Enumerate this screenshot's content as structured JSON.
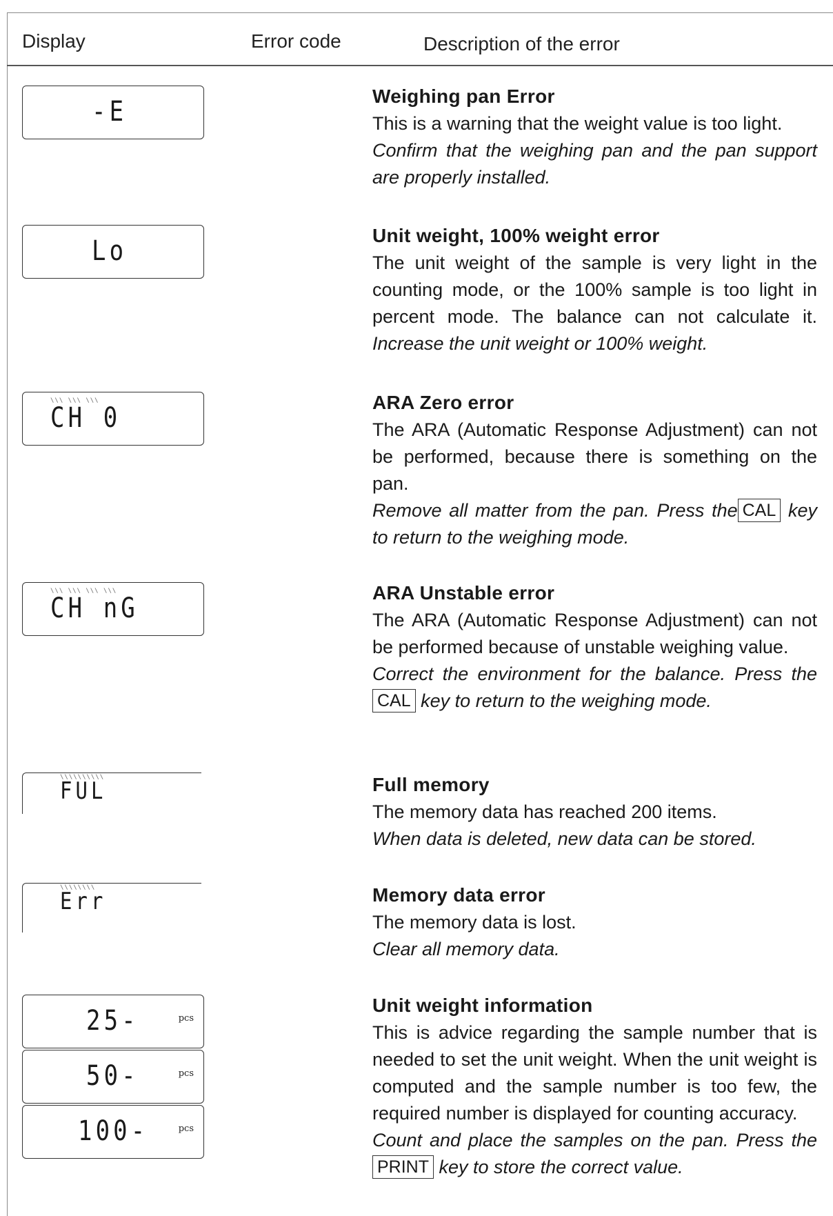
{
  "header": {
    "display": "Display",
    "error_code": "Error code",
    "description": "Description of the error"
  },
  "entries": [
    {
      "display": "-E",
      "title": "Weighing pan Error",
      "text": "This is a warning that the weight value is too light.",
      "instruction": "Confirm that the weighing pan and the pan support are properly installed."
    },
    {
      "display": "Lo",
      "title": "Unit weight, 100% weight error",
      "text": "The unit weight of the sample is very light in the counting mode, or the 100% sample is too light in percent mode. The balance can not calculate it.",
      "instruction": "Increase the unit weight or 100% weight."
    },
    {
      "display": "CH   0",
      "title": "ARA Zero error",
      "text": "The ARA (Automatic Response Adjustment) can not be performed, because there is something on the pan.",
      "instruction_a": "Remove all matter from the pan. Press the",
      "key": "CAL",
      "instruction_b": "key to return to the weighing mode."
    },
    {
      "display": "CH   nG",
      "title": "ARA Unstable error",
      "text": "The ARA (Automatic Response Adjustment) can not be performed because of unstable weighing value.",
      "instruction_a": "Correct the environment for the balance. Press the",
      "key": "CAL",
      "instruction_b": "key to return to the weighing mode."
    },
    {
      "display": "FUL",
      "title": "Full memory",
      "text": "The memory data has reached 200 items.",
      "instruction": "When data is deleted, new data can be stored."
    },
    {
      "display": "Err",
      "title": "Memory data error",
      "text": "The memory data is lost.",
      "instruction": "Clear all memory data."
    },
    {
      "displays": [
        "25-",
        "50-",
        "100-"
      ],
      "unit": "pcs",
      "title": "Unit weight information",
      "text": "This is advice regarding the sample number that is needed to set the unit weight. When the unit weight is computed and the sample number is too few, the required number is displayed for counting accuracy.",
      "instruction_a": "Count and place the samples on the pan. Press the",
      "key": "PRINT",
      "instruction_b": "key to store the correct value."
    }
  ]
}
